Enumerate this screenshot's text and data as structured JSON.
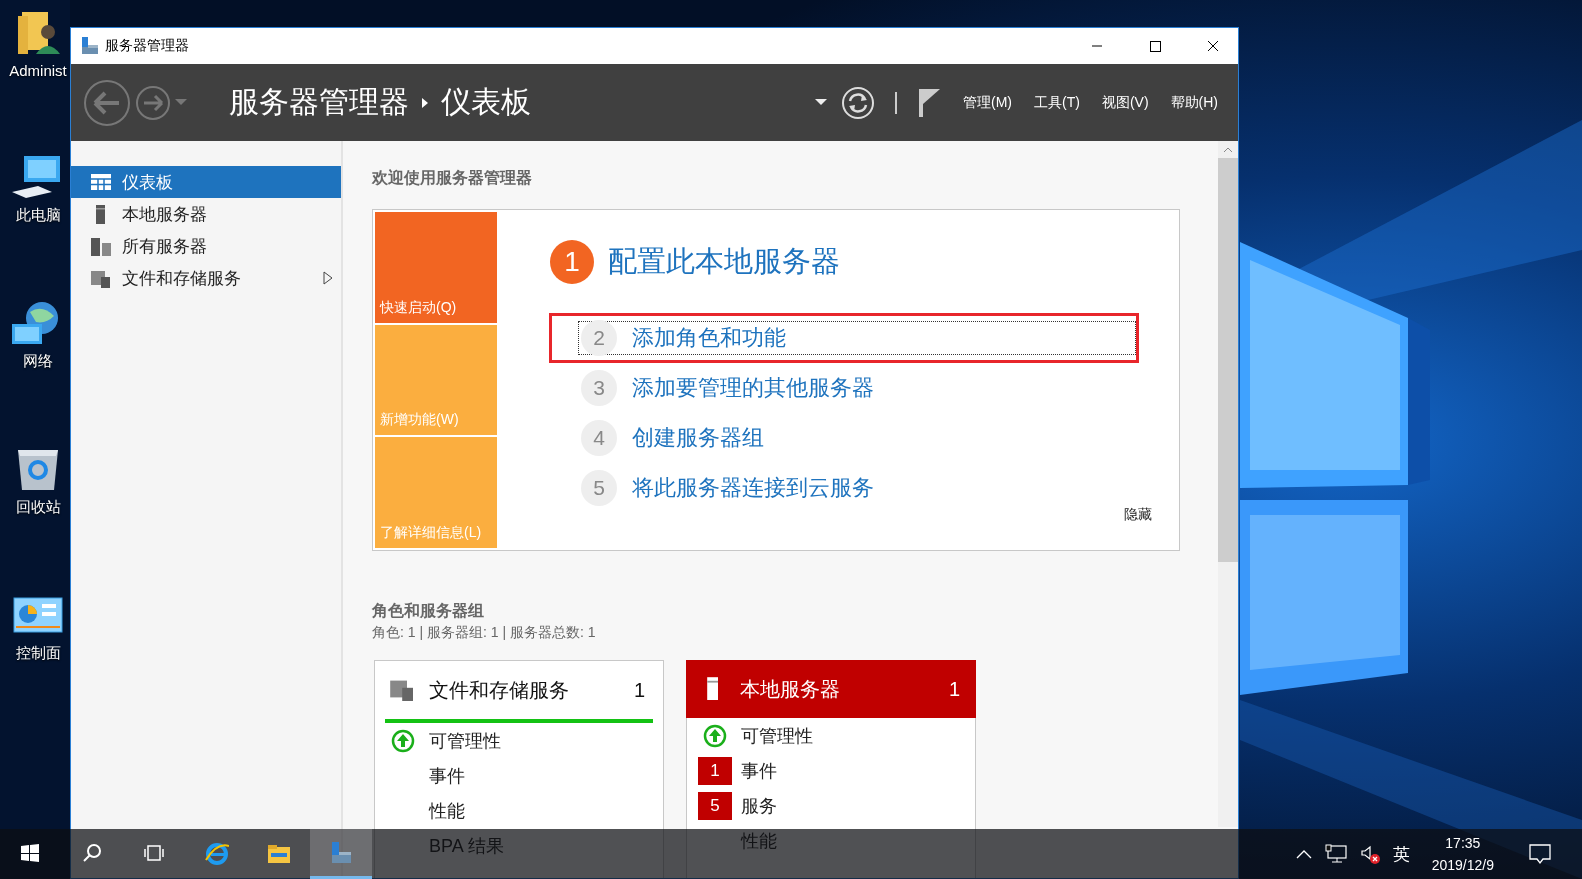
{
  "desktop_icons": [
    {
      "label": "Administ",
      "kind": "user"
    },
    {
      "label": "此电脑",
      "kind": "computer"
    },
    {
      "label": "网络",
      "kind": "network"
    },
    {
      "label": "回收站",
      "kind": "recycle"
    },
    {
      "label": "控制面",
      "kind": "control"
    }
  ],
  "window": {
    "title": "服务器管理器"
  },
  "header": {
    "breadcrumb": [
      "服务器管理器",
      "仪表板"
    ],
    "menus": [
      "管理(M)",
      "工具(T)",
      "视图(V)",
      "帮助(H)"
    ]
  },
  "sidebar": {
    "items": [
      {
        "label": "仪表板",
        "selected": true,
        "has_submenu": false
      },
      {
        "label": "本地服务器",
        "selected": false,
        "has_submenu": false
      },
      {
        "label": "所有服务器",
        "selected": false,
        "has_submenu": false
      },
      {
        "label": "文件和存储服务",
        "selected": false,
        "has_submenu": true
      }
    ]
  },
  "welcome": {
    "title": "欢迎使用服务器管理器",
    "tiles": [
      {
        "label": "快速启动(Q)",
        "selected": true
      },
      {
        "label": "新增功能(W)",
        "selected": false
      },
      {
        "label": "了解详细信息(L)",
        "selected": false
      }
    ],
    "steps": [
      {
        "number": "1",
        "label": "配置此本地服务器",
        "kind": "primary",
        "focused": false,
        "highlighted": false
      },
      {
        "number": "2",
        "label": "添加角色和功能",
        "kind": "secondary",
        "focused": true,
        "highlighted": true
      },
      {
        "number": "3",
        "label": "添加要管理的其他服务器",
        "kind": "secondary",
        "focused": false,
        "highlighted": false
      },
      {
        "number": "4",
        "label": "创建服务器组",
        "kind": "secondary",
        "focused": false,
        "highlighted": false
      },
      {
        "number": "5",
        "label": "将此服务器连接到云服务",
        "kind": "secondary",
        "focused": false,
        "highlighted": false
      }
    ],
    "hide_link": "隐藏"
  },
  "roles": {
    "title": "角色和服务器组",
    "summary": "角色: 1 | 服务器组: 1 | 服务器总数: 1",
    "cards": [
      {
        "title": "文件和存储服务",
        "count": "1",
        "alert": false,
        "rows": [
          {
            "label": "可管理性",
            "kind": "ok"
          },
          {
            "label": "事件",
            "kind": "plain"
          },
          {
            "label": "性能",
            "kind": "plain"
          },
          {
            "label": "BPA 结果",
            "kind": "plain"
          }
        ]
      },
      {
        "title": "本地服务器",
        "count": "1",
        "alert": true,
        "rows": [
          {
            "label": "可管理性",
            "kind": "ok"
          },
          {
            "label": "事件",
            "kind": "badge",
            "badge": "1"
          },
          {
            "label": "服务",
            "kind": "badge",
            "badge": "5"
          },
          {
            "label": "性能",
            "kind": "plain"
          }
        ]
      }
    ]
  },
  "taskbar": {
    "apps": [
      {
        "kind": "start",
        "selected": false
      },
      {
        "kind": "search",
        "selected": false
      },
      {
        "kind": "taskview",
        "selected": false
      },
      {
        "kind": "browser",
        "selected": false
      },
      {
        "kind": "explorer",
        "selected": false
      },
      {
        "kind": "servermanager",
        "selected": true
      }
    ],
    "volume_muted": true,
    "language": "英",
    "time": "17:35",
    "date": "2019/12/9"
  }
}
